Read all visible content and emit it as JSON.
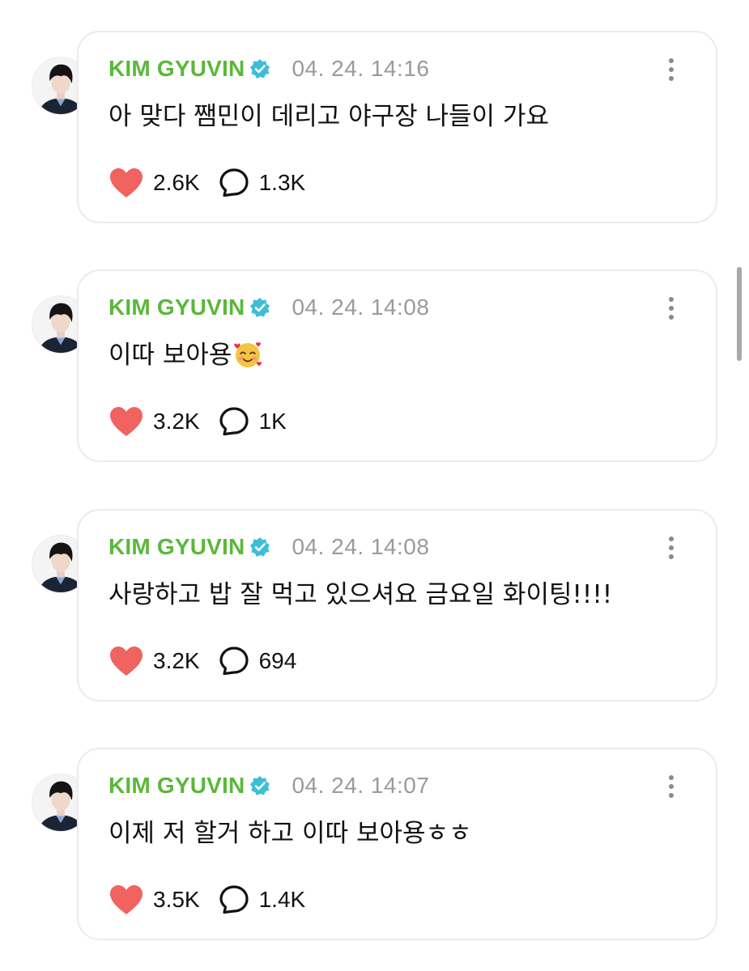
{
  "theme": {
    "author_color": "#5ab839",
    "verified_color": "#3ebed6",
    "heart_color": "#f0635f",
    "time_color": "#9a9a9a"
  },
  "icons": {
    "verified": "verified-badge-icon",
    "more": "more-vertical-icon",
    "like": "heart-icon",
    "comment": "speech-bubble-icon"
  },
  "posts": [
    {
      "author": "KIM GYUVIN",
      "time": "04. 24. 14:16",
      "text": "아 맞다 쨈민이 데리고 야구장 나들이 가요",
      "emoji": "",
      "likes": "2.6K",
      "comments": "1.3K"
    },
    {
      "author": "KIM GYUVIN",
      "time": "04. 24. 14:08",
      "text": "이따 보아용",
      "emoji": "🥰",
      "likes": "3.2K",
      "comments": "1K"
    },
    {
      "author": "KIM GYUVIN",
      "time": "04. 24. 14:08",
      "text": "사랑하고 밥 잘 먹고 있으셔요 금요일 화이팅!!!!",
      "emoji": "",
      "likes": "3.2K",
      "comments": "694"
    },
    {
      "author": "KIM GYUVIN",
      "time": "04. 24. 14:07",
      "text": "이제 저 할거 하고 이따 보아용ㅎㅎ",
      "emoji": "",
      "likes": "3.5K",
      "comments": "1.4K"
    }
  ]
}
